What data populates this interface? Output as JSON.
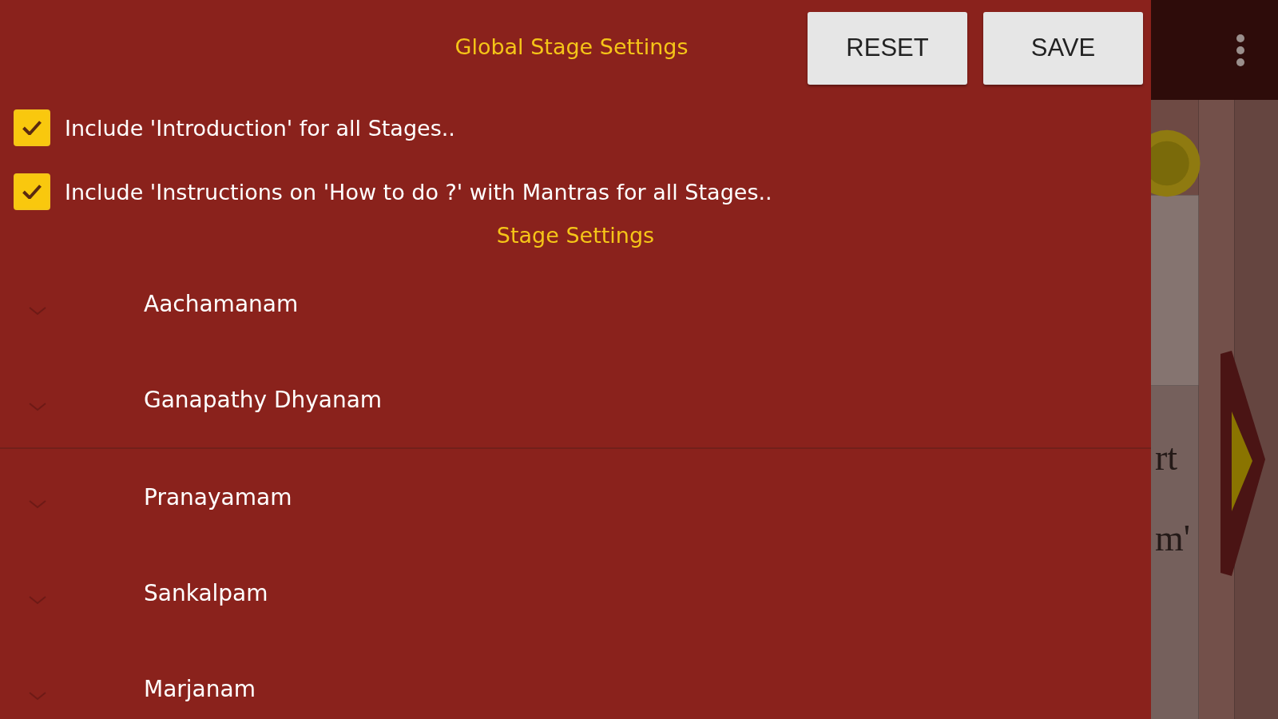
{
  "panel": {
    "title": "Global Stage Settings",
    "buttons": [
      "RESET",
      "SAVE"
    ],
    "options": [
      {
        "label": "Include 'Introduction' for all Stages..",
        "checked": true
      },
      {
        "label": "Include 'Instructions on 'How to do ?' with Mantras for all Stages..",
        "checked": true
      }
    ],
    "section_title": "Stage Settings",
    "stages": [
      {
        "name": "Aachamanam"
      },
      {
        "name": "Ganapathy Dhyanam"
      },
      {
        "name": "Pranayamam"
      },
      {
        "name": "Sankalpam"
      },
      {
        "name": "Marjanam"
      }
    ]
  },
  "background": {
    "texts": [
      "rt",
      "m'"
    ]
  }
}
